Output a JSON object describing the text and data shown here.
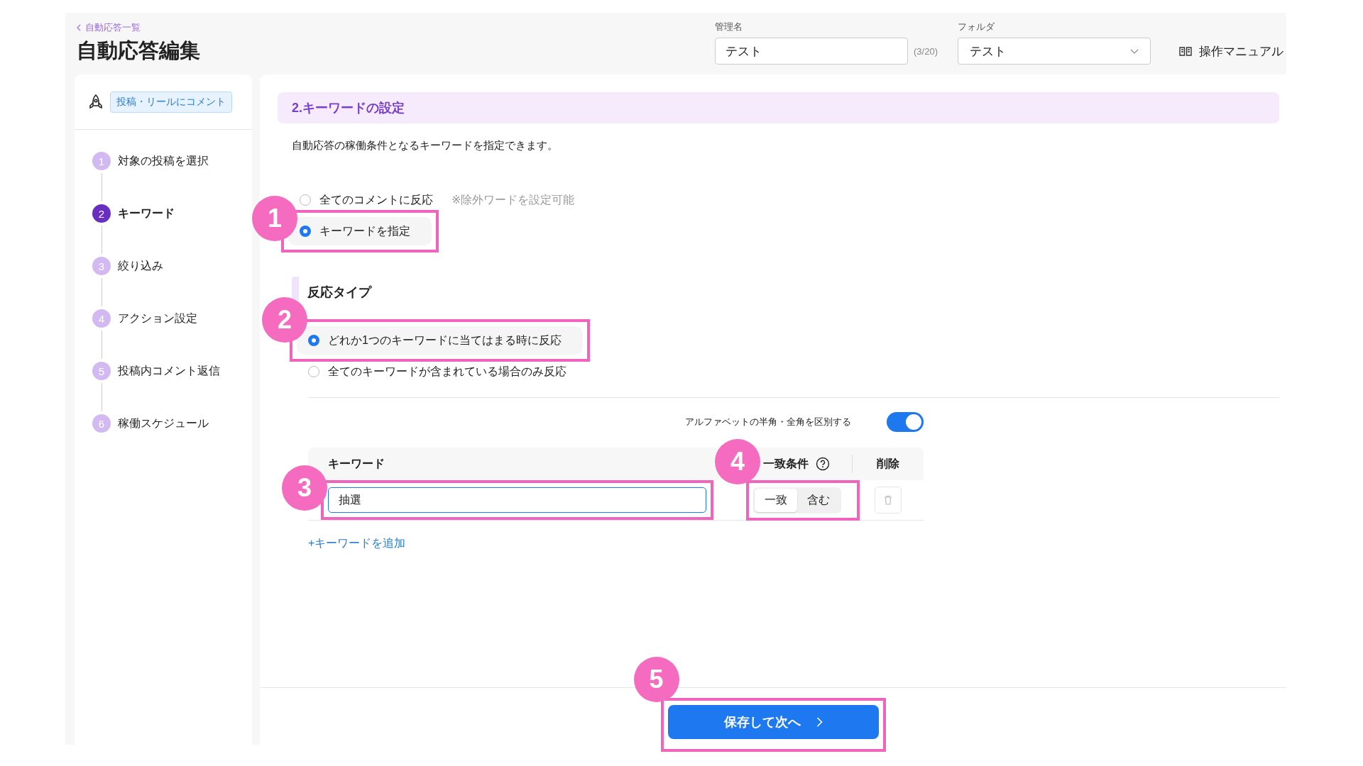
{
  "header": {
    "back_link": "自動応答一覧",
    "title": "自動応答編集",
    "name_field": {
      "label": "管理名",
      "value": "テスト",
      "counter": "(3/20)"
    },
    "folder_select": {
      "label": "フォルダ",
      "value": "テスト"
    },
    "manual_link": "操作マニュアル"
  },
  "sidebar": {
    "trigger_tag": "投稿・リールにコメント",
    "steps": [
      {
        "number": "1",
        "label": "対象の投稿を選択",
        "selected": false
      },
      {
        "number": "2",
        "label": "キーワード",
        "selected": true
      },
      {
        "number": "3",
        "label": "絞り込み",
        "selected": false
      },
      {
        "number": "4",
        "label": "アクション設定",
        "selected": false
      },
      {
        "number": "5",
        "label": "投稿内コメント返信",
        "selected": false
      },
      {
        "number": "6",
        "label": "稼働スケジュール",
        "selected": false
      }
    ]
  },
  "section": {
    "title": "2.キーワードの設定",
    "description": "自動応答の稼働条件となるキーワードを指定できます。",
    "trigger_options": [
      {
        "label": "全てのコメントに反応",
        "note": "※除外ワードを設定可能",
        "selected": false
      },
      {
        "label": "キーワードを指定",
        "selected": true
      }
    ],
    "reaction_type": {
      "title": "反応タイプ",
      "options": [
        {
          "label": "どれか1つのキーワードに当てはまる時に反応",
          "selected": true
        },
        {
          "label": "全てのキーワードが含まれている場合のみ反応",
          "selected": false
        }
      ]
    },
    "case_toggle": {
      "label": "アルファベットの半角・全角を区別する",
      "on": true
    },
    "keyword_table": {
      "columns": [
        "キーワード",
        "一致条件",
        "削除"
      ],
      "rows": [
        {
          "keyword": "抽選",
          "match_options": [
            {
              "label": "一致",
              "selected": true
            },
            {
              "label": "含む",
              "selected": false
            }
          ]
        }
      ]
    },
    "add_keyword_link": "+キーワードを追加"
  },
  "footer": {
    "save_button": "保存して次へ"
  },
  "annotations": [
    {
      "number": "1"
    },
    {
      "number": "2"
    },
    {
      "number": "3"
    },
    {
      "number": "4"
    },
    {
      "number": "5"
    }
  ]
}
